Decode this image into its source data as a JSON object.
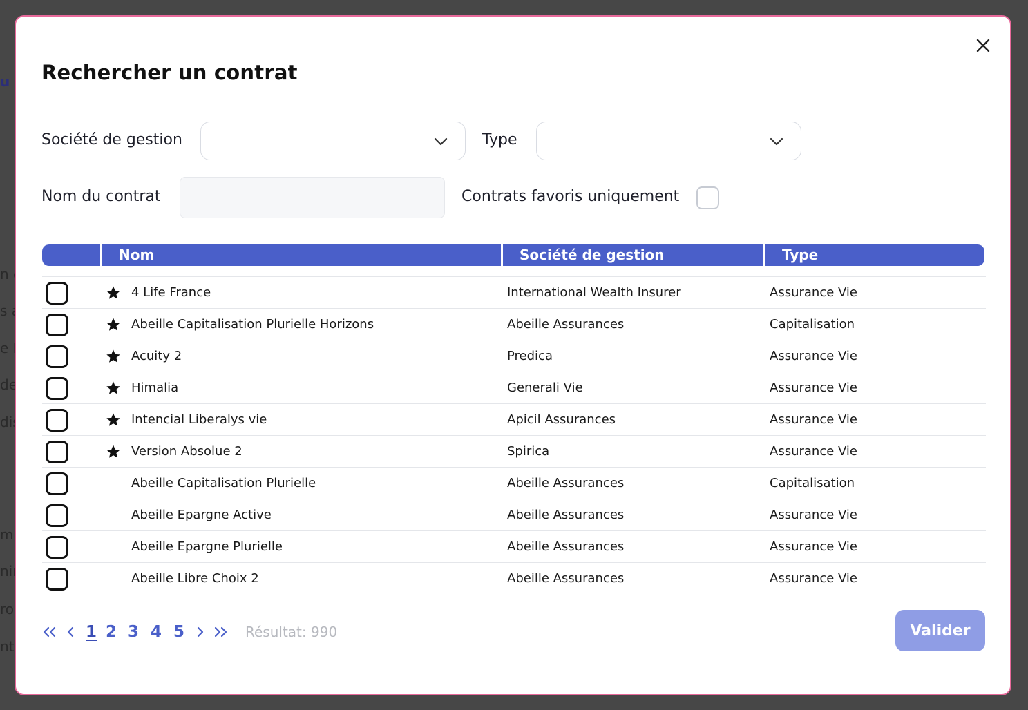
{
  "modal": {
    "title": "Rechercher un contrat",
    "filters": {
      "societe_label": "Société de gestion",
      "type_label": "Type",
      "nom_label": "Nom du contrat",
      "nom_value": "",
      "favoris_label": "Contrats favoris uniquement",
      "favoris_checked": false
    },
    "table": {
      "columns": [
        "Nom",
        "Société de gestion",
        "Type"
      ],
      "rows": [
        {
          "favorite": true,
          "nom": "4 Life France",
          "societe": "International Wealth Insurer",
          "type": "Assurance Vie"
        },
        {
          "favorite": true,
          "nom": "Abeille Capitalisation Plurielle Horizons",
          "societe": "Abeille Assurances",
          "type": "Capitalisation"
        },
        {
          "favorite": true,
          "nom": "Acuity 2",
          "societe": "Predica",
          "type": "Assurance Vie"
        },
        {
          "favorite": true,
          "nom": "Himalia",
          "societe": "Generali Vie",
          "type": "Assurance Vie"
        },
        {
          "favorite": true,
          "nom": "Intencial Liberalys vie",
          "societe": "Apicil Assurances",
          "type": "Assurance Vie"
        },
        {
          "favorite": true,
          "nom": "Version Absolue 2",
          "societe": "Spirica",
          "type": "Assurance Vie"
        },
        {
          "favorite": false,
          "nom": "Abeille Capitalisation Plurielle",
          "societe": "Abeille Assurances",
          "type": "Capitalisation"
        },
        {
          "favorite": false,
          "nom": "Abeille Epargne Active",
          "societe": "Abeille Assurances",
          "type": "Assurance Vie"
        },
        {
          "favorite": false,
          "nom": "Abeille Epargne Plurielle",
          "societe": "Abeille Assurances",
          "type": "Assurance Vie"
        },
        {
          "favorite": false,
          "nom": "Abeille Libre Choix 2",
          "societe": "Abeille Assurances",
          "type": "Assurance Vie"
        }
      ]
    },
    "pagination": {
      "pages": [
        "1",
        "2",
        "3",
        "4",
        "5"
      ],
      "current_page": "1",
      "result_text": "Résultat: 990"
    },
    "valider_label": "Valider"
  },
  "background_fragments": [
    "u c",
    "n c",
    "s a",
    "e N",
    "de",
    "dis",
    "mi",
    "nin",
    "ro",
    "nt"
  ],
  "colors": {
    "accent": "#4a5fc9",
    "modal_border": "#e7699a",
    "button_disabled": "#8f9de5",
    "overlay": "#474747"
  },
  "icons": {
    "close": "close-icon",
    "dropdown": "chevron-down-icon",
    "favorite": "star-icon",
    "first_page": "double-chevron-left-icon",
    "prev_page": "chevron-left-icon",
    "next_page": "chevron-right-icon",
    "last_page": "double-chevron-right-icon"
  }
}
